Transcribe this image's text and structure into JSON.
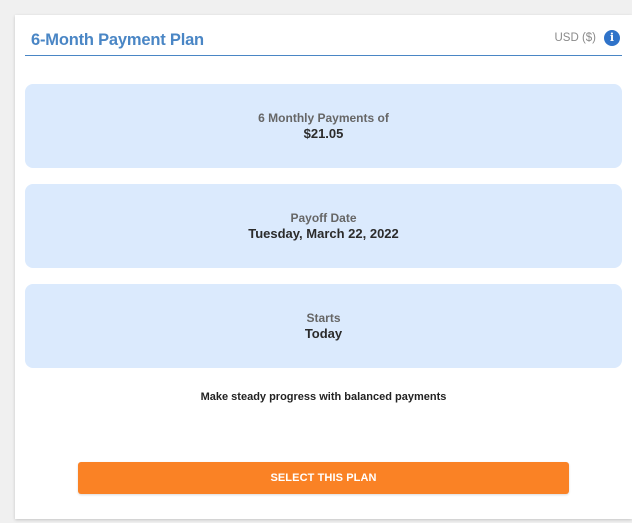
{
  "header": {
    "title": "6-Month Payment Plan",
    "currency": "USD ($)",
    "info_icon": "info-icon"
  },
  "boxes": [
    {
      "label": "6 Monthly Payments of",
      "value": "$21.05"
    },
    {
      "label": "Payoff Date",
      "value": "Tuesday, March 22, 2022"
    },
    {
      "label": "Starts",
      "value": "Today"
    }
  ],
  "tagline": "Make steady progress with balanced payments",
  "select_button": {
    "label": "SELECT THIS PLAN"
  },
  "colors": {
    "accent": "#4a86c5",
    "box_background": "#dbeafd",
    "button": "#fa8225",
    "info_icon": "#2f73c9"
  }
}
